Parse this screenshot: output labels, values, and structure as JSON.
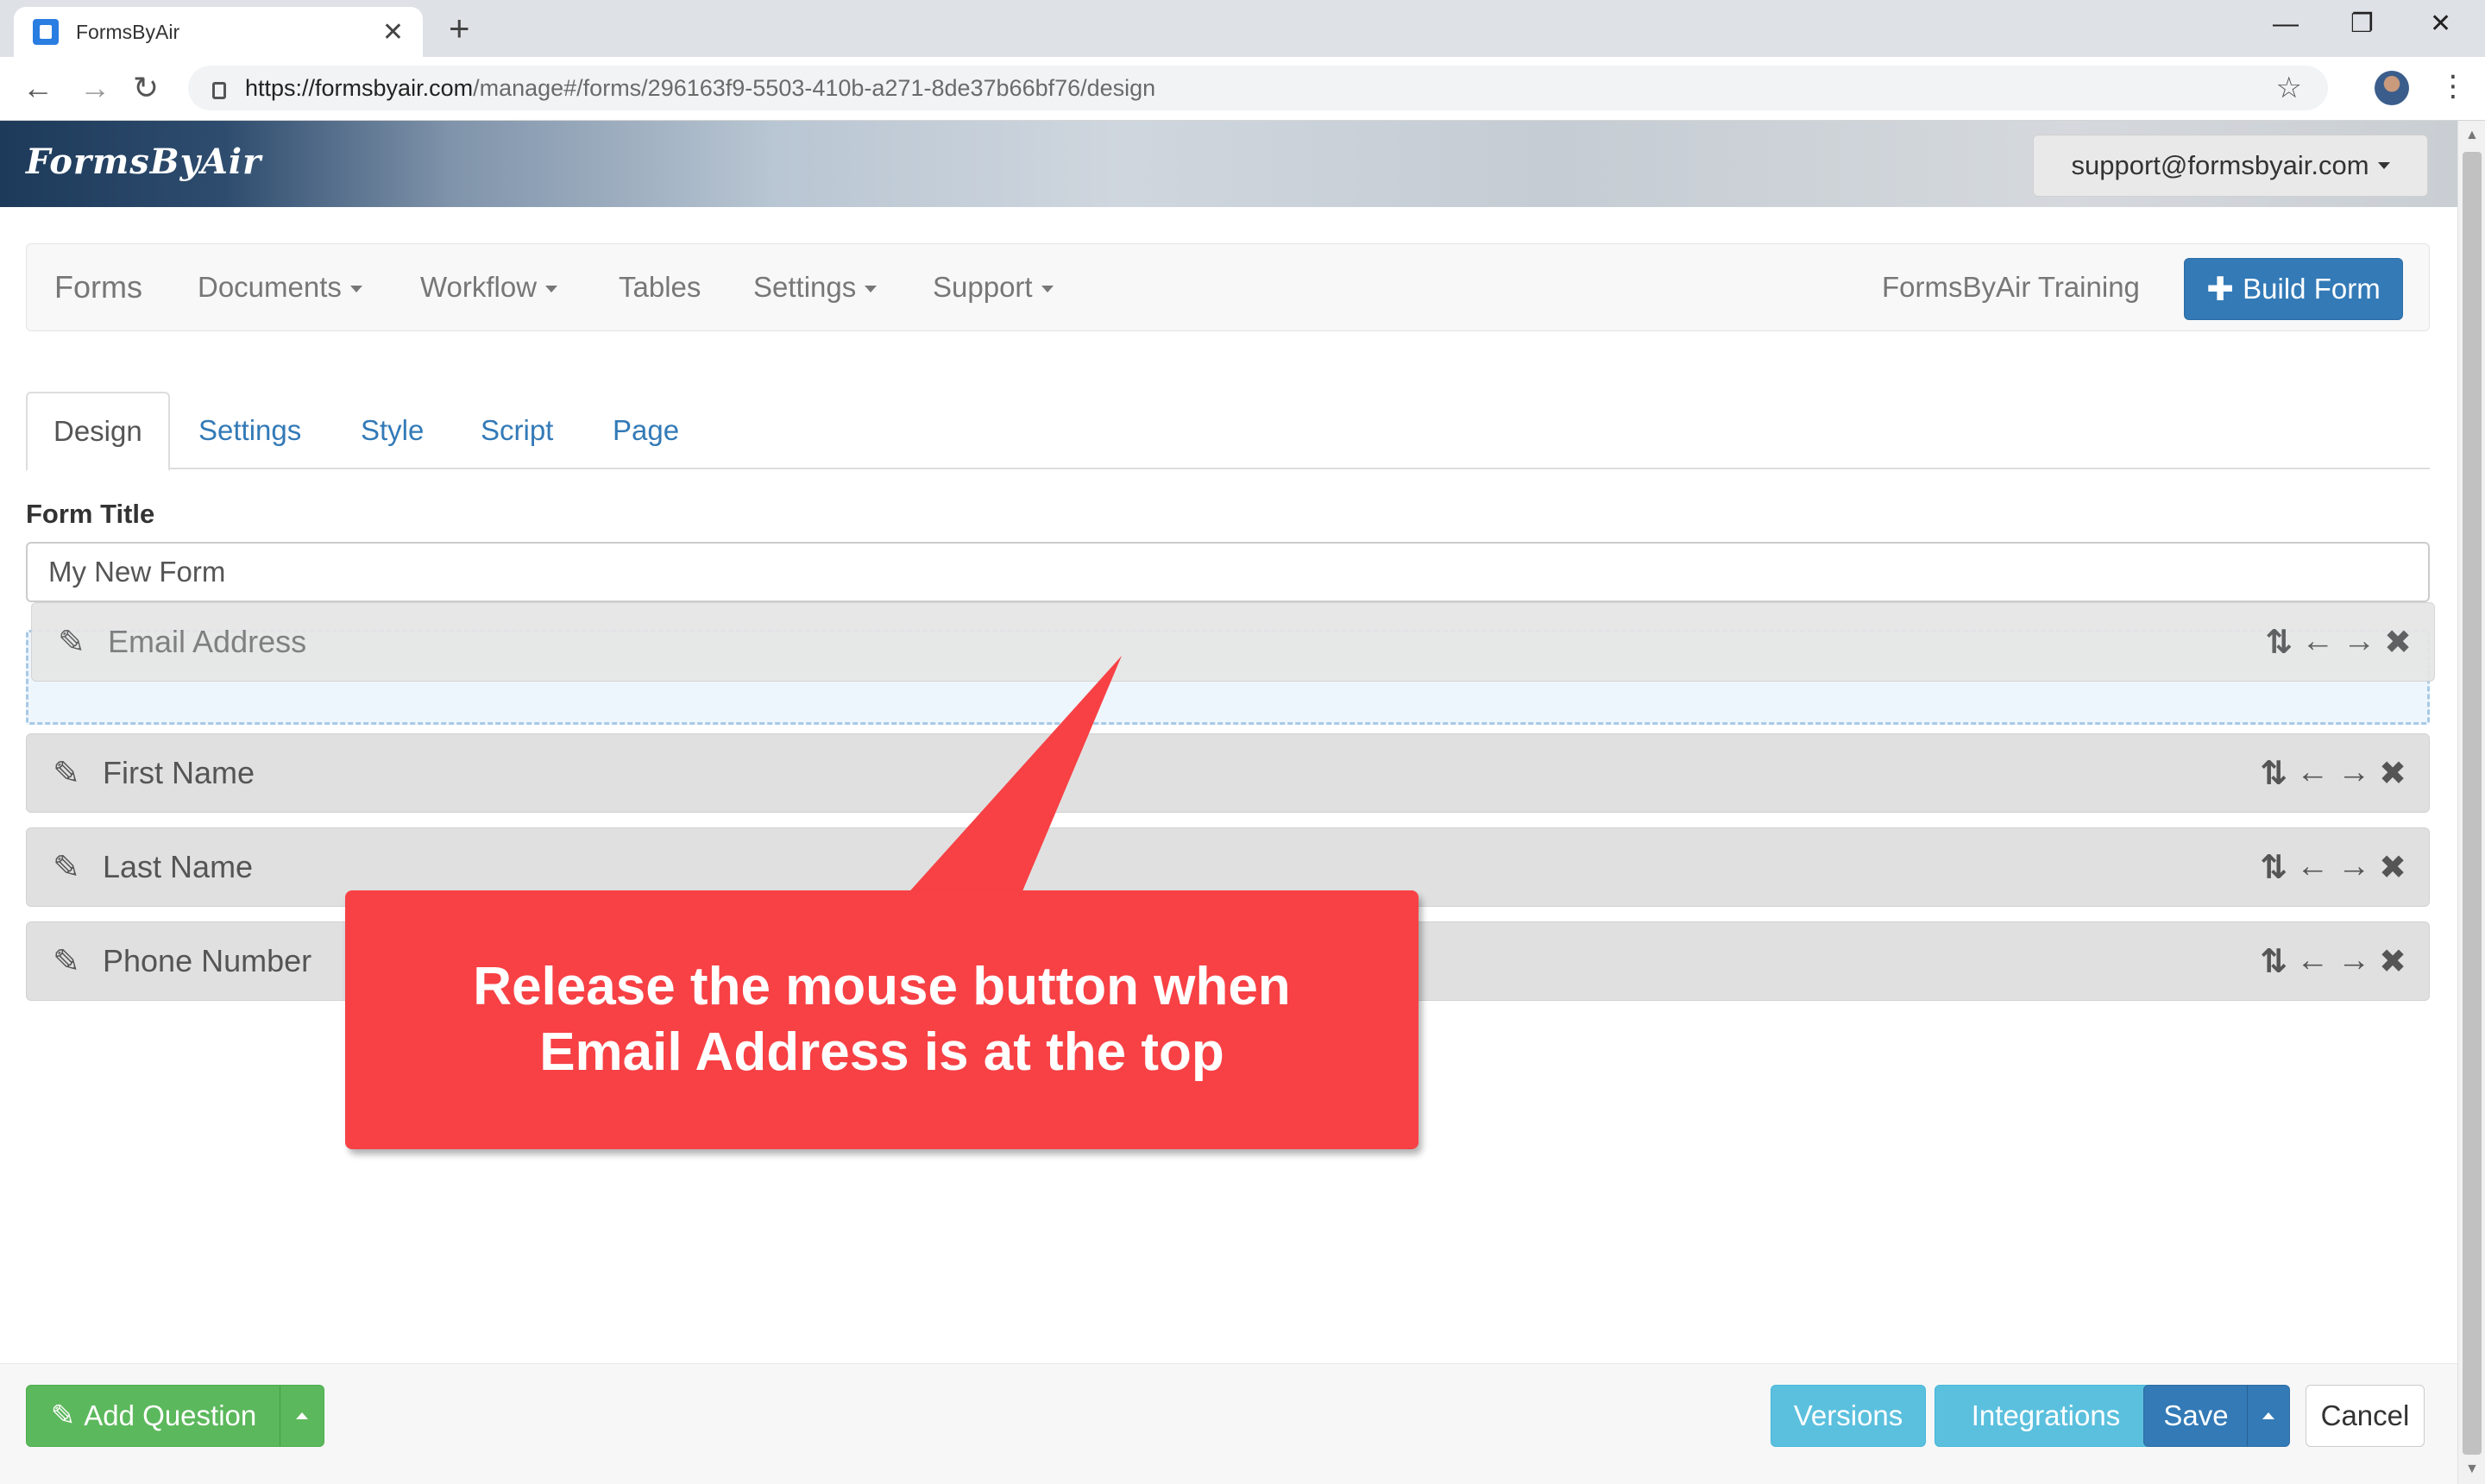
{
  "browser": {
    "tab_title": "FormsByAir",
    "tab_close": "✕",
    "new_tab": "+",
    "url_host": "https://formsbyair.com",
    "url_path": "/manage#/forms/296163f9-5503-410b-a271-8de37b66bf76/design",
    "minimize": "—",
    "restore": "❐",
    "close": "✕"
  },
  "header": {
    "brand": "FormsByAir",
    "account": "support@formsbyair.com"
  },
  "nav": {
    "forms": "Forms",
    "documents": "Documents",
    "workflow": "Workflow",
    "tables": "Tables",
    "settings": "Settings",
    "support": "Support",
    "org": "FormsByAir Training",
    "build_form": "Build Form"
  },
  "tabs": {
    "design": "Design",
    "settings": "Settings",
    "style": "Style",
    "script": "Script",
    "page": "Page"
  },
  "form": {
    "title_label": "Form Title",
    "title_value": "My New Form"
  },
  "questions": [
    {
      "label": "Email Address"
    },
    {
      "label": "First Name"
    },
    {
      "label": "Last Name"
    },
    {
      "label": "Phone Number"
    }
  ],
  "icons": {
    "pencil": "✎",
    "reorder": "⇅",
    "left": "←",
    "right": "→",
    "remove": "✖"
  },
  "callout": {
    "line1": "Release the mouse button when",
    "line2": "Email Address is at the top",
    "color": "#f74145"
  },
  "footer": {
    "add_question": "Add Question",
    "versions": "Versions",
    "integrations": "Integrations",
    "save": "Save",
    "cancel": "Cancel"
  }
}
